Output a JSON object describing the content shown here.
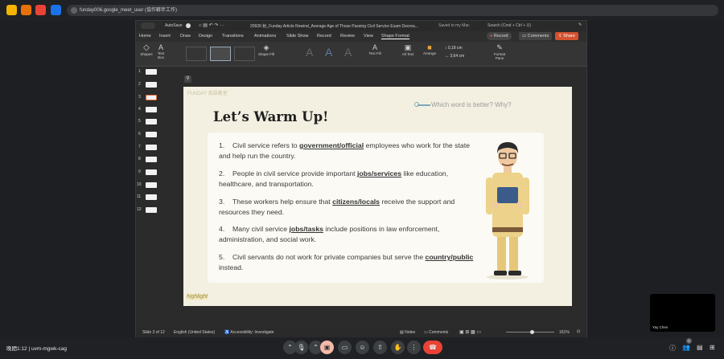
{
  "browser": {
    "url": "funday006.google_meet_user (協作夥伴工作)",
    "accent_colors": [
      "#f4b400",
      "#e8710a",
      "#ea4335",
      "#1a73e8"
    ]
  },
  "ppt": {
    "titlebar": {
      "autosave": "AutoSave",
      "doc_title": "20926 射_Funday Article Rewind_Average Age of Those Passing Civil Service Exam Decrea...",
      "saved": "Saved to my Mac",
      "search": "Search (Cmd + Ctrl + U)"
    },
    "menu": [
      "Home",
      "Insert",
      "Draw",
      "Design",
      "Transitions",
      "Animations",
      "Slide Show",
      "Record",
      "Review",
      "View",
      "Shape Format"
    ],
    "record_label": "Record",
    "comments_label": "Comments",
    "share_label": "Share",
    "ribbon": {
      "shapes": "Shapes",
      "textbox": "Text Box",
      "shape_fill": "Shape Fill",
      "text_fill": "Text Fill",
      "alt_text": "Alt Text",
      "arrange": "Arrange",
      "height": "0,18 cm",
      "width": "3,64 cm",
      "format_pane": "Format Pane"
    },
    "thumb_numbers": [
      "1",
      "2",
      "3",
      "4",
      "5",
      "6",
      "7",
      "8",
      "9",
      "10",
      "11",
      "12"
    ],
    "slide": {
      "logo": "FUNDAY 英語教室",
      "title": "Let’s Warm Up!",
      "question": "Which word is better? Why?",
      "highlight": "highlight",
      "items": [
        {
          "n": "1.",
          "pre": "Civil service refers to ",
          "bold": "government/official",
          "post": " employees who work for the state and help run the country."
        },
        {
          "n": "2.",
          "pre": "People in civil service provide important ",
          "bold": "jobs/services",
          "post": " like education, healthcare, and transportation."
        },
        {
          "n": "3.",
          "pre": "These workers help ensure that ",
          "bold": "citizens/locals",
          "post": " receive the support and resources they need."
        },
        {
          "n": "4.",
          "pre": "Many civil service ",
          "bold": "jobs/tasks",
          "post": " include positions in law enforcement, administration, and social work."
        },
        {
          "n": "5.",
          "pre": "Civil servants do not work for private companies but serve the ",
          "bold": "country/public",
          "post": " instead."
        }
      ]
    },
    "status": {
      "slide_count": "Slide 3 of 12",
      "language": "English (United States)",
      "accessibility": "Accessibility: Investigate",
      "notes": "Notes",
      "comments": "Comments",
      "zoom": "161%"
    }
  },
  "meeting": {
    "info": "晚間1:12 | uvm-mgwk-cag",
    "tile_name": "Yay Chen",
    "participants_count": "5"
  }
}
